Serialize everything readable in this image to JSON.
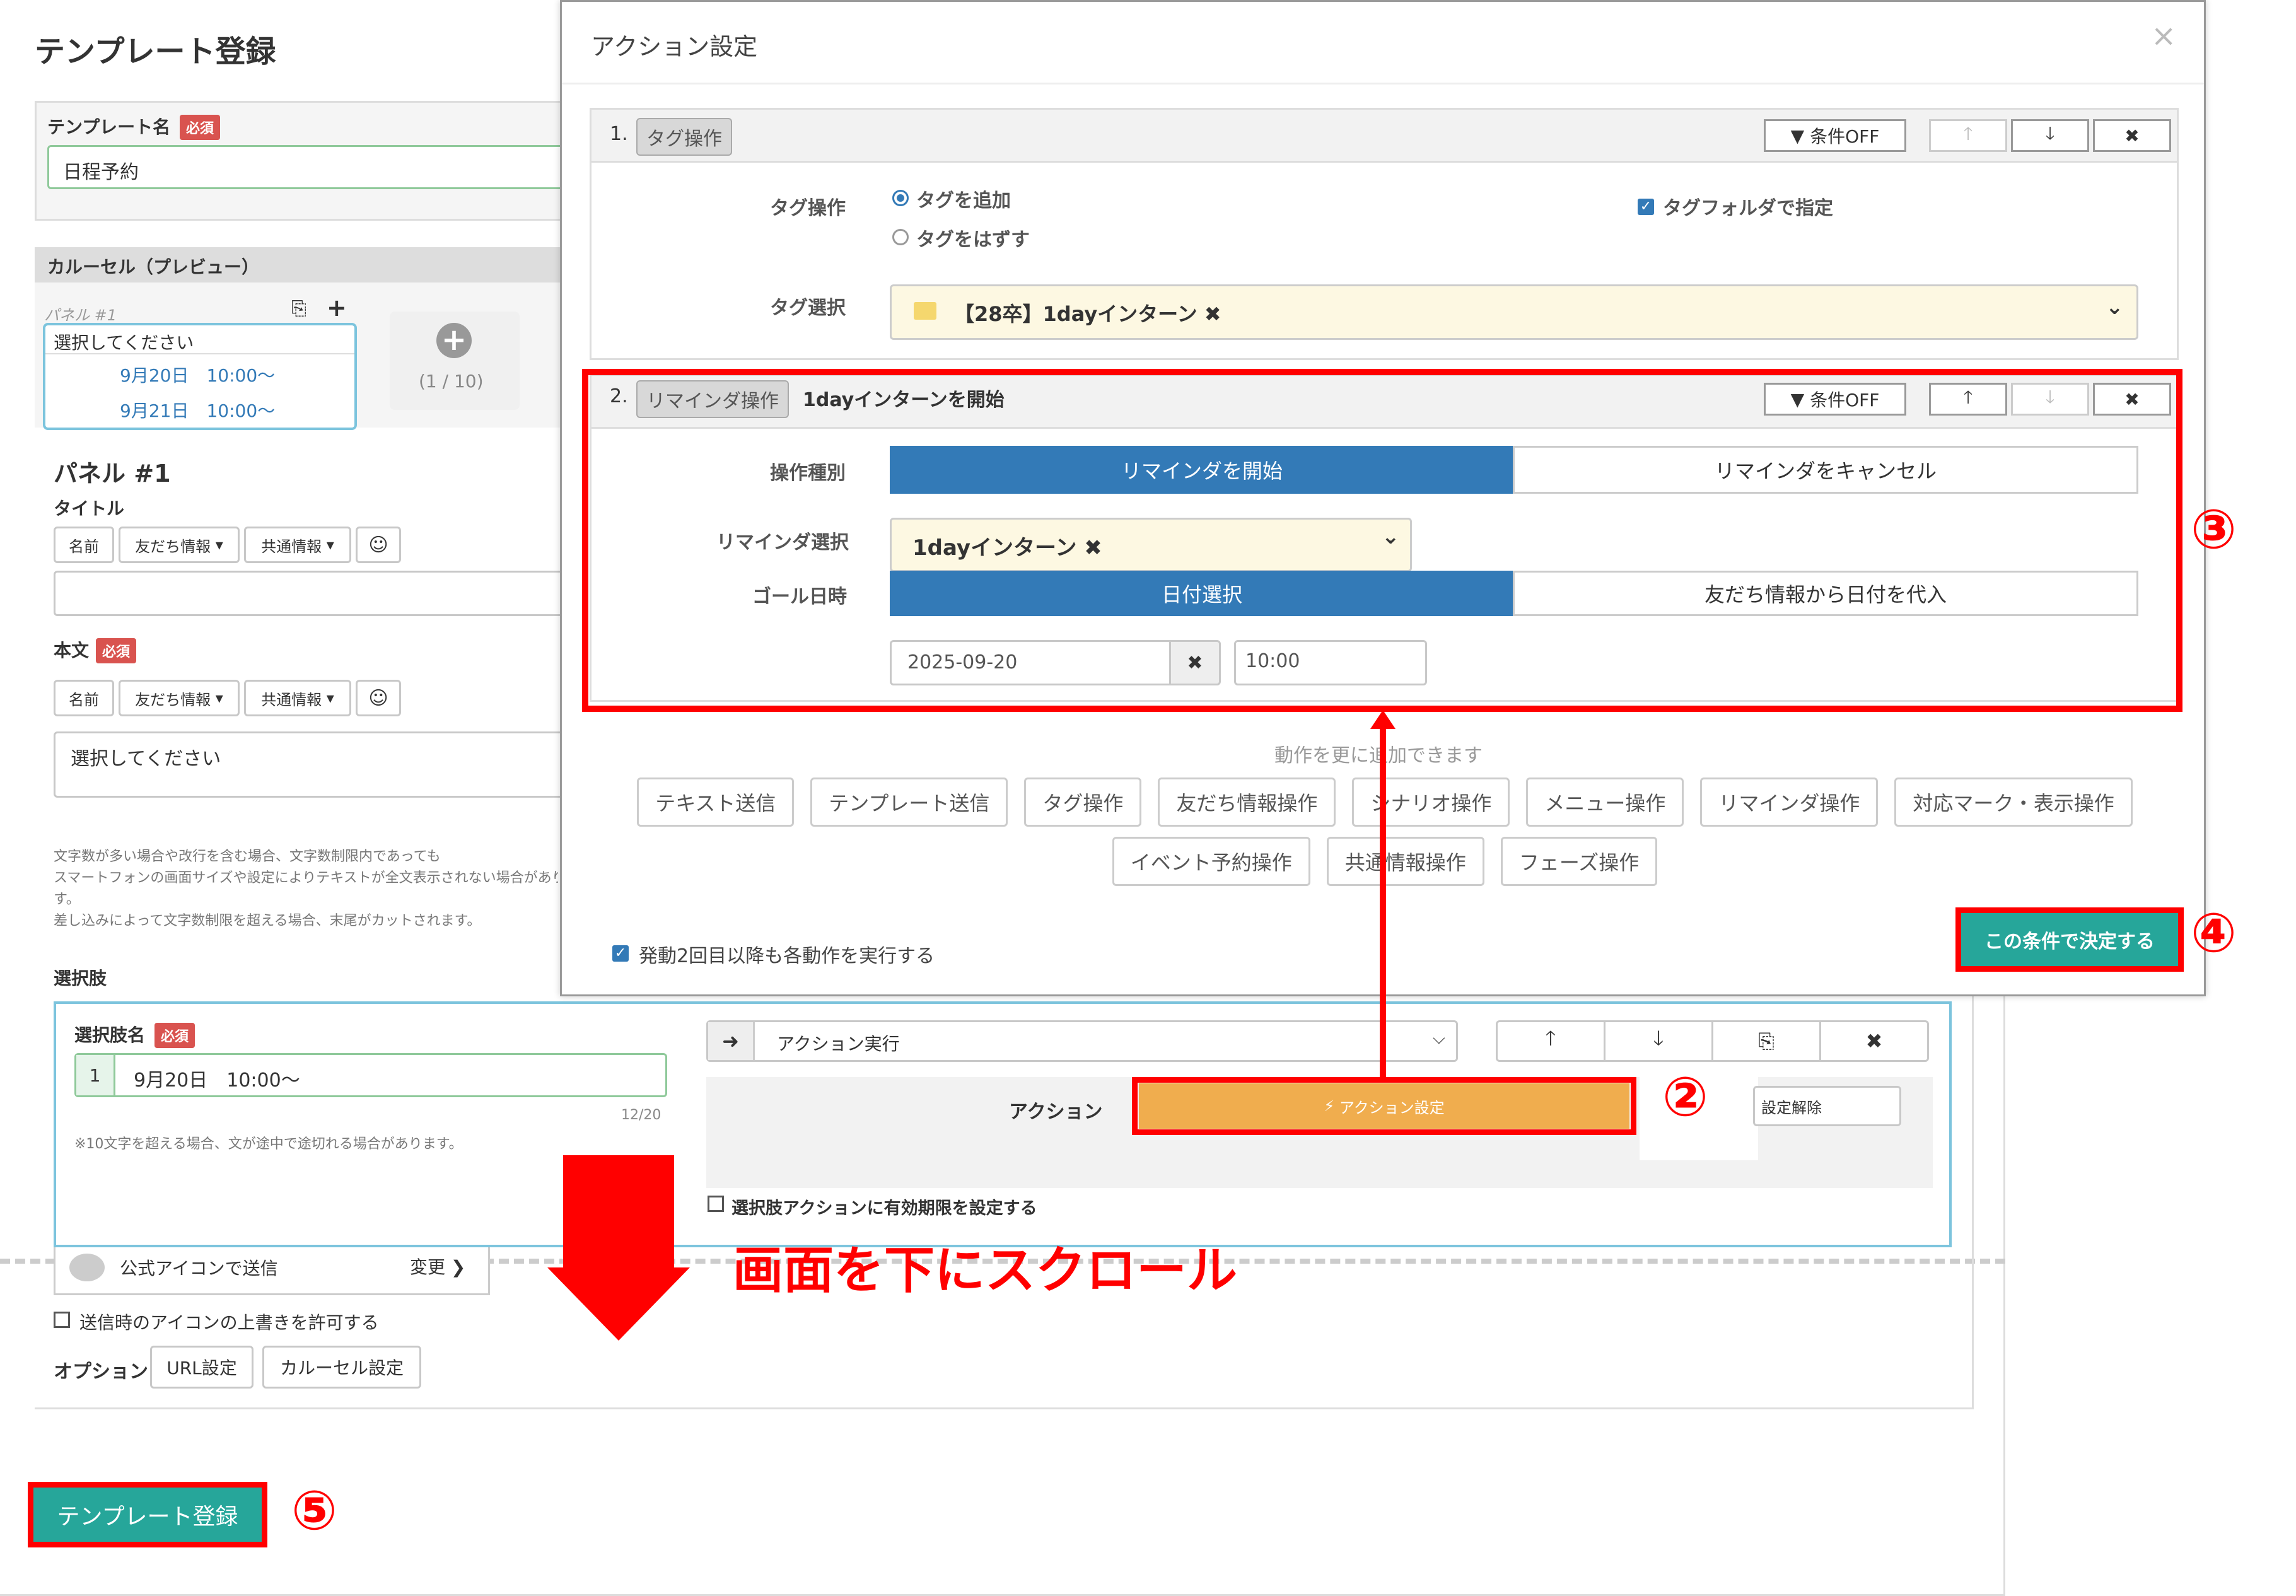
{
  "page_title": "テンプレート登録",
  "template_name": {
    "label": "テンプレート名",
    "required": "必須",
    "value": "日程予約"
  },
  "carousel": {
    "header": "カルーセル（プレビュー）",
    "panel_label": "パネル #1",
    "preview_title": "選択してください",
    "preview_items": [
      "9月20日　10:00〜",
      "9月21日　10:00〜"
    ],
    "counter": "(1 / 10)"
  },
  "panel": {
    "heading": "パネル #1",
    "title_label": "タイトル",
    "body_label": "本文",
    "required": "必須",
    "toolbar": {
      "name": "名前",
      "friend": "友だち情報",
      "common": "共通情報"
    },
    "body_value": "選択してください",
    "notes": [
      "文字数が多い場合や改行を含む場合、文字数制限内であっても",
      "スマートフォンの画面サイズや設定によりテキストが全文表示されない場合があります。",
      "す。",
      "差し込みによって文字数制限を超える場合、末尾がカットされます。"
    ]
  },
  "choice": {
    "section_label": "選択肢",
    "name_label": "選択肢名",
    "required": "必須",
    "index": "1",
    "value": "9月20日　10:00〜",
    "count": "12/20",
    "note": "※10文字を超える場合、文が途中で途切れる場合があります。",
    "action_select": "アクション実行",
    "action_label": "アクション",
    "action_button": "アクション設定",
    "action_release": "設定解除",
    "expiry_checkbox": "選択肢アクションに有効期限を設定する"
  },
  "bottom": {
    "icon_send": "公式アイコンで送信",
    "change": "変更",
    "override_checkbox": "送信時のアイコンの上書きを許可する",
    "options_label": "オプション",
    "url_setting": "URL設定",
    "carousel_setting": "カルーセル設定",
    "register_button": "テンプレート登録"
  },
  "modal": {
    "title": "アクション設定",
    "close": "×",
    "block1": {
      "num": "1.",
      "badge": "タグ操作",
      "cond_off": "条件OFF",
      "tag_op_label": "タグ操作",
      "radio_add": "タグを追加",
      "radio_remove": "タグをはずす",
      "folder_checkbox": "タグフォルダで指定",
      "tag_select_label": "タグ選択",
      "tag_value": "【28卒】1dayインターン"
    },
    "block2": {
      "num": "2.",
      "badge": "リマインダ操作",
      "title": "1dayインターンを開始",
      "cond_off": "条件OFF",
      "op_type_label": "操作種別",
      "op_start": "リマインダを開始",
      "op_cancel": "リマインダをキャンセル",
      "reminder_select_label": "リマインダ選択",
      "reminder_value": "1dayインターン",
      "goal_label": "ゴール日時",
      "goal_date_select": "日付選択",
      "goal_from_friend": "友だち情報から日付を代入",
      "date_value": "2025-09-20",
      "time_value": "10:00"
    },
    "add_hint": "動作を更に追加できます",
    "add_buttons_row1": [
      "テキスト送信",
      "テンプレート送信",
      "タグ操作",
      "友だち情報操作",
      "シナリオ操作",
      "メニュー操作",
      "リマインダ操作",
      "対応マーク・表示操作"
    ],
    "add_buttons_row2": [
      "イベント予約操作",
      "共通情報操作",
      "フェーズ操作"
    ],
    "repeat_checkbox": "発動2回目以降も各動作を実行する",
    "confirm_button": "この条件で決定する"
  },
  "annotations": {
    "scroll_text": "画面を下にスクロール",
    "n2": "②",
    "n3": "③",
    "n4": "④",
    "n5": "⑤"
  },
  "colors": {
    "primary_blue": "#337ab7",
    "teal": "#26a69a",
    "orange": "#f0ad4e",
    "red": "#ff0000",
    "required": "#d9534f"
  }
}
